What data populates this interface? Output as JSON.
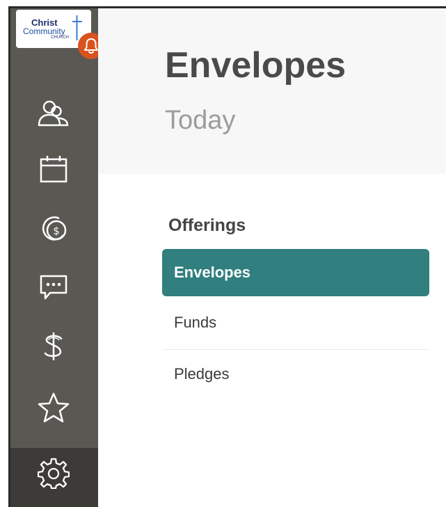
{
  "brand": {
    "logo_line1": "Christ",
    "logo_line2": "Community",
    "logo_line3": "CHURCH",
    "accent_color": "#d9531e",
    "sidebar_color": "#5a5853",
    "active_color": "#317f7f"
  },
  "sidebar": {
    "items": [
      {
        "icon": "people-icon"
      },
      {
        "icon": "calendar-icon"
      },
      {
        "icon": "coins-icon"
      },
      {
        "icon": "chat-icon"
      },
      {
        "icon": "dollar-icon"
      },
      {
        "icon": "star-icon"
      },
      {
        "icon": "gear-icon"
      }
    ]
  },
  "header": {
    "title": "Envelopes",
    "subtitle": "Today"
  },
  "offerings": {
    "heading": "Offerings",
    "items": [
      {
        "label": "Envelopes",
        "active": true
      },
      {
        "label": "Funds",
        "active": false
      },
      {
        "label": "Pledges",
        "active": false
      }
    ]
  }
}
